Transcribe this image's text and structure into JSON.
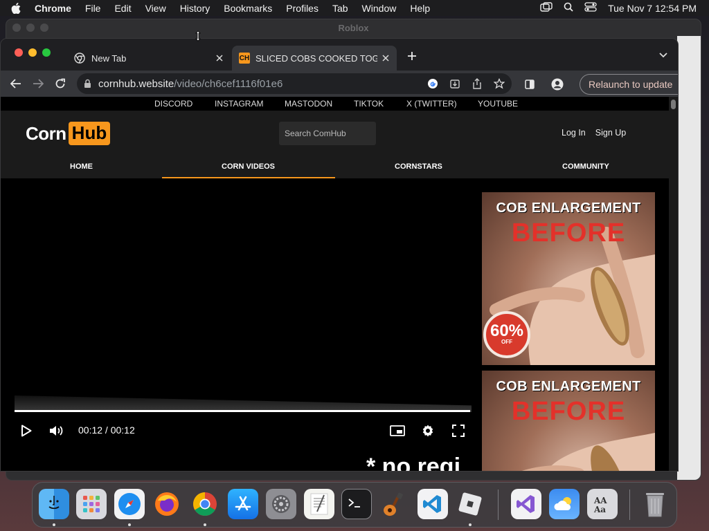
{
  "menubar": {
    "app_name": "Chrome",
    "items": [
      "File",
      "Edit",
      "View",
      "History",
      "Bookmarks",
      "Profiles",
      "Tab",
      "Window",
      "Help"
    ],
    "clock": "Tue Nov 7  12:54 PM"
  },
  "background_window": {
    "title": "Roblox"
  },
  "browser": {
    "tabs": [
      {
        "label": "New Tab",
        "active": false
      },
      {
        "label": "SLICED COBS COOKED TOGETHER",
        "active": true,
        "favicon_text": "CH"
      }
    ],
    "url": {
      "host": "cornhub.website",
      "path": "/video/ch6cef1116f01e6"
    },
    "relaunch_label": "Relaunch to update"
  },
  "site": {
    "social_links": [
      "DISCORD",
      "INSTAGRAM",
      "MASTODON",
      "TIKTOK",
      "X (TWITTER)",
      "YOUTUBE"
    ],
    "logo": {
      "left": "Corn",
      "right": "Hub"
    },
    "search_placeholder": "Search ComHub",
    "auth": {
      "login": "Log In",
      "signup": "Sign Up"
    },
    "nav": [
      {
        "label": "HOME",
        "active": false
      },
      {
        "label": "CORN VIDEOS",
        "active": true
      },
      {
        "label": "CORNSTARS",
        "active": false
      },
      {
        "label": "COMMUNITY",
        "active": false
      }
    ],
    "accent_color": "#f7971d"
  },
  "player": {
    "time": "00:12 / 00:12",
    "progress": 1.0,
    "tease_text": "* no regi"
  },
  "ads": [
    {
      "headline": "COB ENLARGEMENT",
      "subhead": "BEFORE",
      "badge_pct": "60%",
      "badge_off": "OFF"
    },
    {
      "headline": "COB ENLARGEMENT",
      "subhead": "BEFORE"
    }
  ],
  "dock": {
    "apps": [
      "Finder",
      "Launchpad",
      "Safari",
      "Firefox",
      "Chrome",
      "App Store",
      "System Settings",
      "TextEdit",
      "Terminal",
      "GarageBand",
      "VS Code",
      "Roblox",
      "Visual Studio",
      "Weather",
      "Font Book",
      "Trash"
    ]
  }
}
